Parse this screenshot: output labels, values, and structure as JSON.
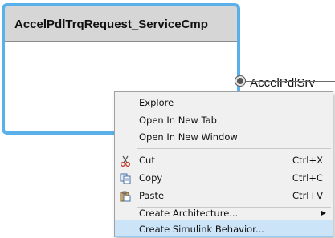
{
  "component": {
    "title": "AccelPdlTrqRequest_ServiceCmp",
    "port_label": "AccelPdlSrv",
    "border_color": "#5ab0e8"
  },
  "context_menu": {
    "items": [
      {
        "label": "Explore"
      },
      {
        "label": "Open In New Tab"
      },
      {
        "label": "Open In New Window"
      },
      {
        "label": "Cut",
        "shortcut": "Ctrl+X",
        "icon": "scissors-icon"
      },
      {
        "label": "Copy",
        "shortcut": "Ctrl+C",
        "icon": "copy-icon"
      },
      {
        "label": "Paste",
        "shortcut": "Ctrl+V",
        "icon": "paste-icon"
      },
      {
        "label": "Create Architecture...",
        "submenu": "▶"
      },
      {
        "label": "Create Simulink Behavior...",
        "highlighted": true
      }
    ],
    "highlight_color": "#cce4f7"
  }
}
